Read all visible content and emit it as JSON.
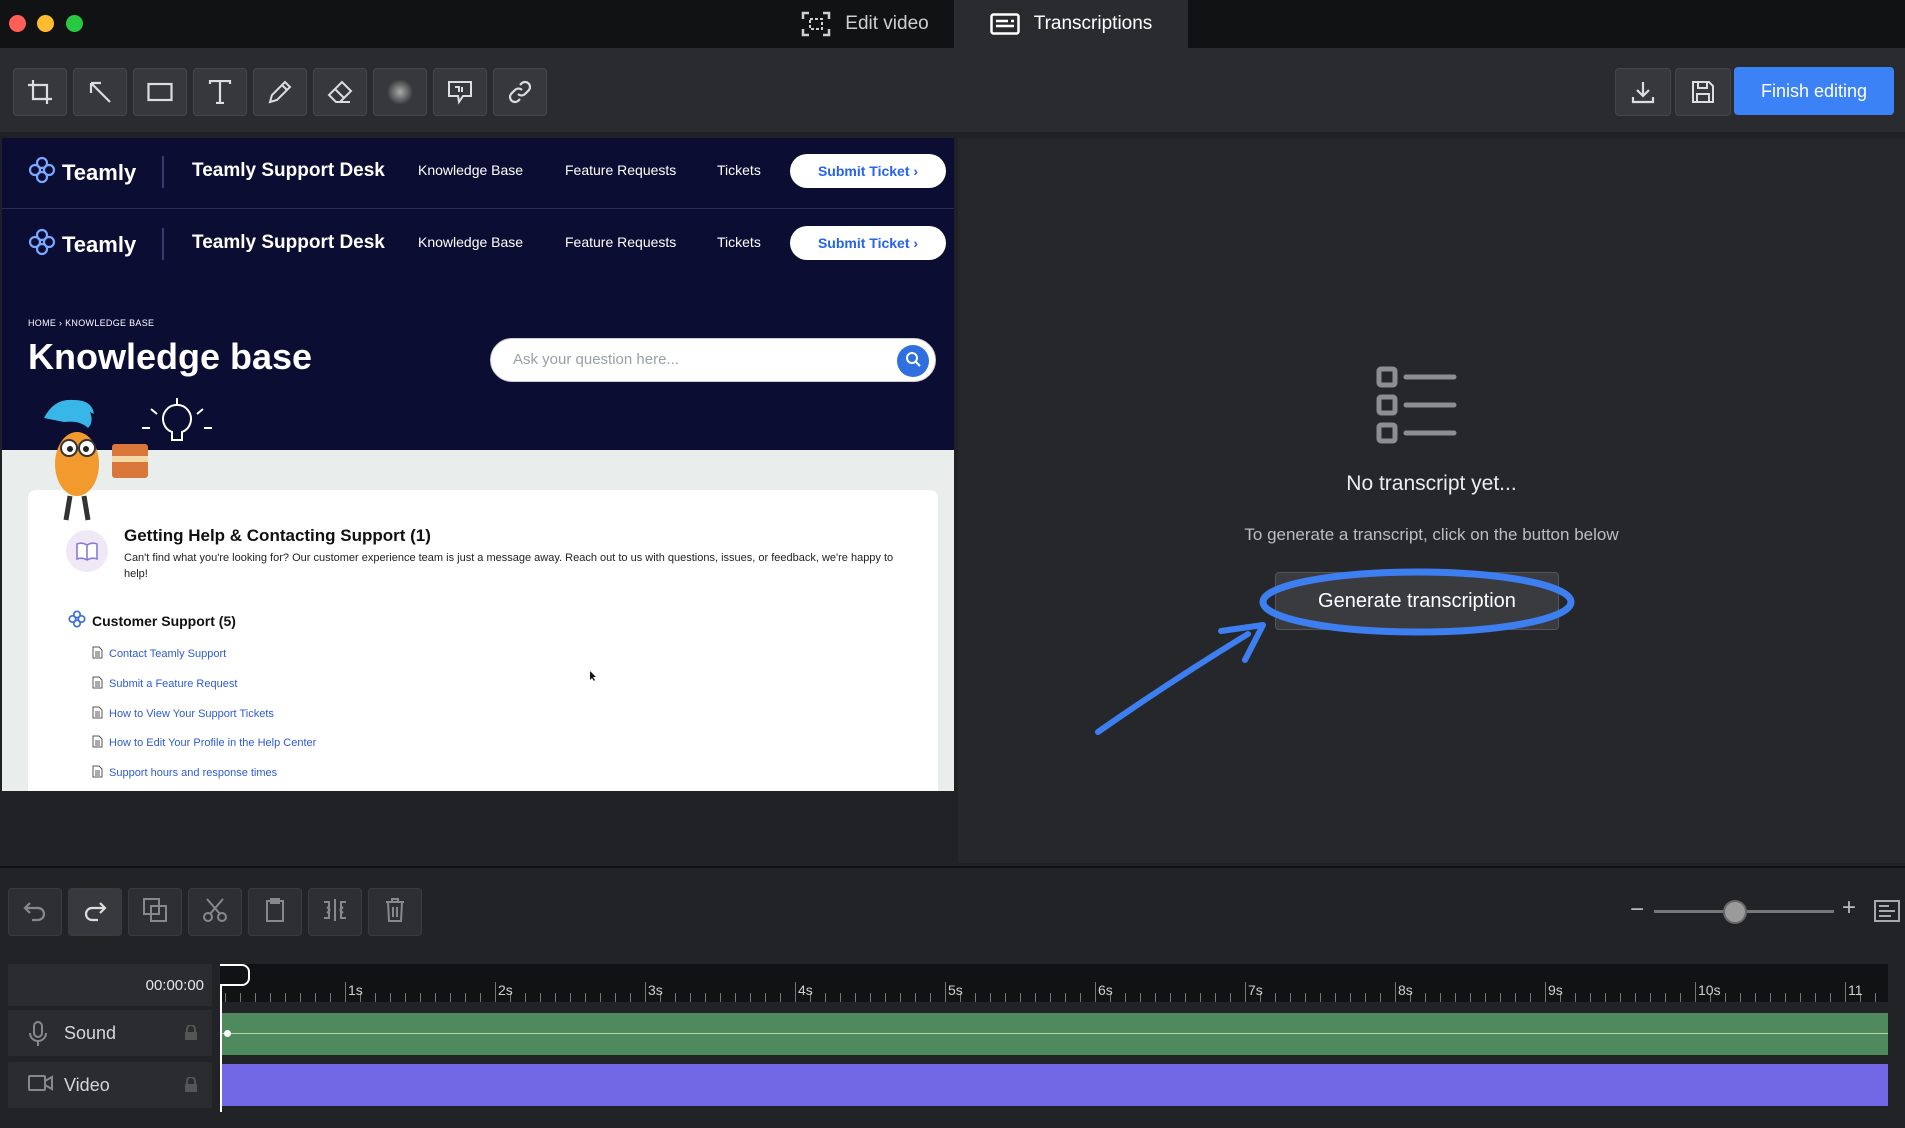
{
  "window": {
    "traffic_colors": [
      "#ff5f57",
      "#febc2e",
      "#28c840"
    ],
    "tabs": [
      {
        "label": "Edit video",
        "icon": "screen-select-icon",
        "active": false
      },
      {
        "label": "Transcriptions",
        "icon": "subtitles-icon",
        "active": true
      }
    ]
  },
  "toolbar": {
    "tools": [
      "crop-icon",
      "arrow-icon",
      "rectangle-icon",
      "text-icon",
      "pen-icon",
      "eraser-icon",
      "blur-icon",
      "callout-icon",
      "link-icon"
    ],
    "download_icon": "download-icon",
    "save_icon": "save-icon",
    "finish_label": "Finish editing",
    "accent": "#3b82f6"
  },
  "preview": {
    "site": {
      "brand": "Teamly",
      "desk_title": "Teamly Support Desk",
      "nav_links": [
        "Knowledge Base",
        "Feature Requests",
        "Tickets"
      ],
      "submit_label": "Submit Ticket ›",
      "breadcrumb": "HOME  ›  KNOWLEDGE BASE",
      "page_title": "Knowledge base",
      "search_placeholder": "Ask your question here...",
      "category": {
        "title": "Getting Help & Contacting Support (1)",
        "description": "Can't find what you're looking for? Our customer experience team is just a message away. Reach out to us with questions, issues, or feedback, we're happy to help!"
      },
      "subcategory": {
        "title": "Customer Support (5)",
        "articles": [
          "Contact Teamly Support",
          "Submit a Feature Request",
          "How to View Your Support Tickets",
          "How to Edit Your Profile in the Help Center",
          "Support hours and response times"
        ]
      }
    },
    "player": {
      "volume_fraction": 0.9
    }
  },
  "transcription": {
    "heading": "No transcript yet...",
    "subtext": "To generate a transcript, click on the button below",
    "button_label": "Generate transcription",
    "annotation_color": "#3d7ff0"
  },
  "timeline": {
    "edit_buttons": [
      "undo-icon",
      "redo-icon",
      "duplicate-icon",
      "scissors-icon",
      "clipboard-icon",
      "split-icon",
      "trash-icon"
    ],
    "current_time": "00:00:00",
    "ruler_labels": [
      "1s",
      "2s",
      "3s",
      "4s",
      "5s",
      "6s",
      "7s",
      "8s",
      "9s",
      "10s",
      "11"
    ],
    "tracks": [
      {
        "name": "Sound",
        "color": "#4e8a5d"
      },
      {
        "name": "Video",
        "color": "#7268e6"
      }
    ],
    "zoom_fraction": 0.45
  }
}
